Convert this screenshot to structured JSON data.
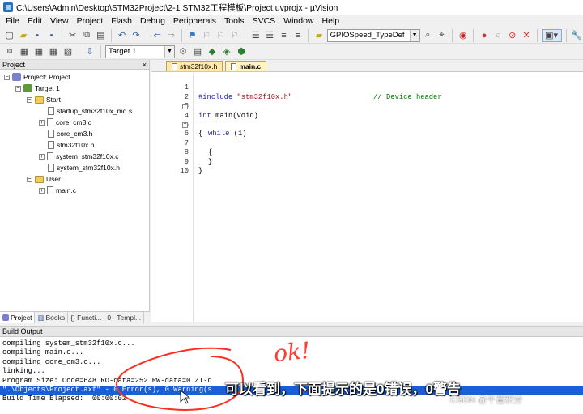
{
  "title_bar": {
    "title": "C:\\Users\\Admin\\Desktop\\STM32Project\\2-1 STM32工程模板\\Project.uvprojx - µVision"
  },
  "menu": [
    "File",
    "Edit",
    "View",
    "Project",
    "Flash",
    "Debug",
    "Peripherals",
    "Tools",
    "SVCS",
    "Window",
    "Help"
  ],
  "toolbar": {
    "find_combo": "GPIOSpeed_TypeDef",
    "target_combo": "Target 1"
  },
  "project_panel": {
    "header": "Project",
    "close": "×",
    "tree": {
      "root": "Project: Project",
      "target": "Target 1",
      "group_start": "Start",
      "start_files": [
        "startup_stm32f10x_md.s",
        "core_cm3.c",
        "core_cm3.h",
        "stm32f10x.h",
        "system_stm32f10x.c",
        "system_stm32f10x.h"
      ],
      "group_user": "User",
      "user_files": [
        "main.c"
      ]
    },
    "tabs": [
      "Project",
      "Books",
      "{} Functi...",
      "0+ Templ..."
    ]
  },
  "editor": {
    "tabs": [
      "stm32f10x.h",
      "main.c"
    ],
    "active_tab": "main.c",
    "lines": [
      {
        "n": "1",
        "pre": "#include ",
        "str": "\"stm32f10x.h\"",
        "cmt": "// Device header"
      },
      {
        "n": "2"
      },
      {
        "n": "3",
        "kw": "int",
        "text": " main(void)"
      },
      {
        "n": "4",
        "text": "{"
      },
      {
        "n": "5",
        "kw": "while",
        "text": " (1)"
      },
      {
        "n": "6",
        "text": "{"
      },
      {
        "n": "7"
      },
      {
        "n": "8",
        "text": "}"
      },
      {
        "n": "9",
        "text": "}"
      },
      {
        "n": "10"
      }
    ]
  },
  "build_output": {
    "header": "Build Output",
    "lines": [
      "compiling system_stm32f10x.c...",
      "compiling main.c...",
      "compiling core_cm3.c...",
      "linking...",
      "Program Size: Code=648 RO-data=252 RW-data=0 ZI-d",
      "\".\\Objects\\Project.axf\" - 0 Error(s), 0 Warning(s",
      "Build Time Elapsed:  00:00:02"
    ]
  },
  "overlay": {
    "annotation": "ok!",
    "subtitle": "可以看到，下面提示的是0错误，0警告",
    "watermark": "CSDN @千董积分"
  }
}
